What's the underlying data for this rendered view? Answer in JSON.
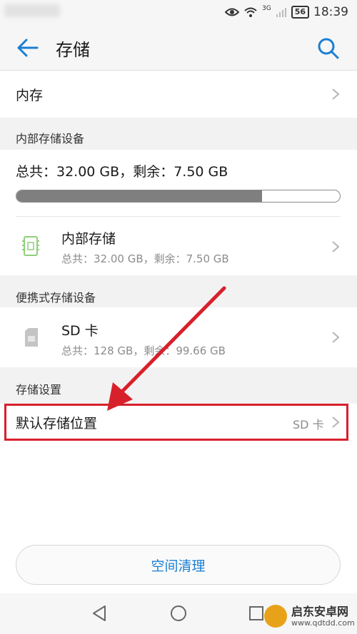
{
  "status_bar": {
    "network": "3G",
    "battery": "56",
    "time": "18:39"
  },
  "header": {
    "title": "存储"
  },
  "rows": {
    "memory": {
      "label": "内存"
    },
    "default_location": {
      "label": "默认存储位置",
      "value": "SD 卡"
    }
  },
  "internal_section": {
    "title": "内部存储设备",
    "summary": "总共：32.00 GB，剩余：7.50 GB",
    "used_fraction": 0.76,
    "item": {
      "name": "内部存储",
      "detail": "总共：32.00 GB，剩余：7.50 GB"
    }
  },
  "portable_section": {
    "title": "便携式存储设备",
    "item": {
      "name": "SD 卡",
      "detail": "总共：128 GB，剩余：99.66 GB"
    }
  },
  "settings_section": {
    "title": "存储设置"
  },
  "clean_button": {
    "label": "空间清理"
  },
  "watermark": {
    "text": "启东安卓网",
    "url": "www.qdtdd.com"
  },
  "colors": {
    "accent": "#1a7fd2",
    "annotation": "#d7202b",
    "chip_green": "#8fcf7a"
  }
}
